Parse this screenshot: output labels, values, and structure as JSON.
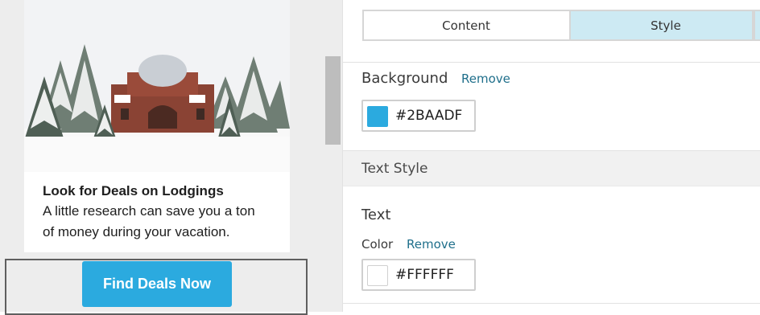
{
  "preview": {
    "card": {
      "title": "Look for Deals on Lodgings",
      "body_line1": "A little research can save you a ton",
      "body_line2": "of money during your vacation."
    },
    "button_label": "Find Deals Now"
  },
  "panel": {
    "tabs": [
      {
        "label": "Content",
        "active": false
      },
      {
        "label": "Style",
        "active": true
      }
    ],
    "background": {
      "label": "Background",
      "remove_label": "Remove",
      "color": "#2BAADF"
    },
    "text_style_section": "Text Style",
    "text": {
      "label": "Text",
      "color_label": "Color",
      "remove_label": "Remove",
      "color": "#FFFFFF"
    }
  },
  "colors": {
    "accent": "#2baadf",
    "tab_active": "#cdeaf3",
    "link": "#1f6f8b"
  }
}
